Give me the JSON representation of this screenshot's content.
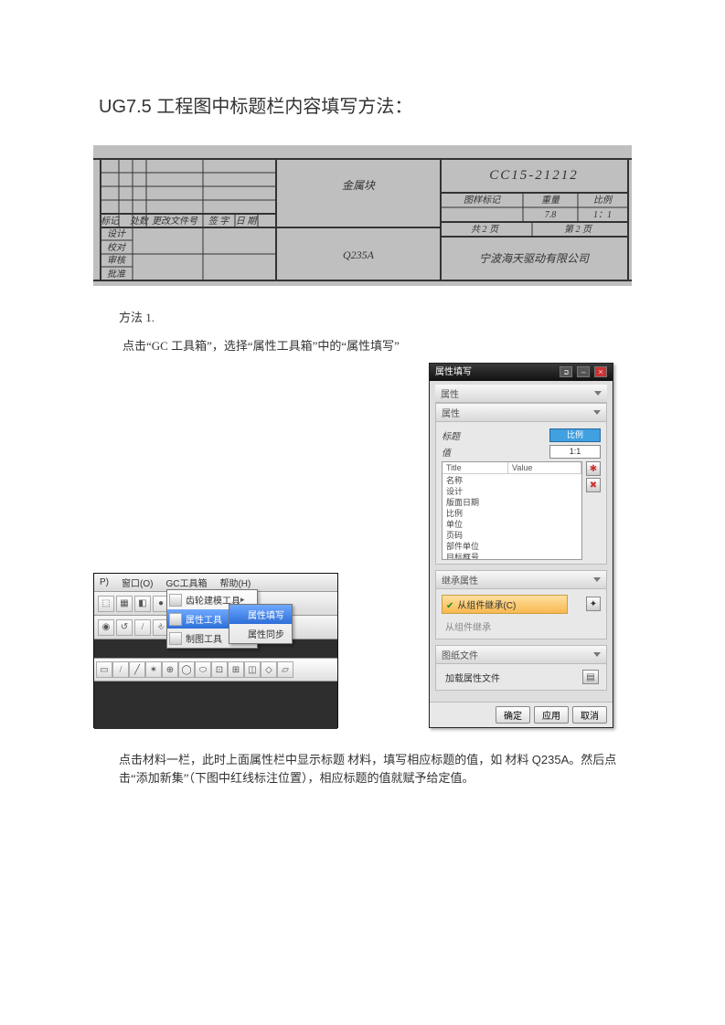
{
  "title_prefix": "UG7.5",
  "title_rest": " 工程图中标题栏内容填写方法：",
  "titleblock": {
    "part_no": "CC15-21212",
    "part_name": "金属块",
    "material": "Q235A",
    "hdr_mark": "标记",
    "hdr_place": "处数",
    "hdr_file": "更改文件号",
    "hdr_sign": "签 字",
    "hdr_date": "日 期",
    "row_design": "设计",
    "row_check": "校对",
    "row_review": "审核",
    "row_approve": "批准",
    "lbl_drawmark": "图样标记",
    "lbl_weight": "重量",
    "lbl_scale": "比例",
    "val_weight": "7.8",
    "val_scale": "1：1",
    "sheet_total": "共 2 页",
    "sheet_this": "第 2 页",
    "company": "宁波海天驱动有限公司"
  },
  "method_label": "方法 1.",
  "step1_text": "点击“GC 工具箱”，选择“属性工具箱”中的“属性填写”",
  "menubar": {
    "a": "P)",
    "b": "窗口(O)",
    "c": "GC工具箱",
    "d": "帮助(H)"
  },
  "main_menu": {
    "m1": "齿轮建模工具",
    "m2": "属性工具",
    "m3": "制图工具"
  },
  "sub_menu": {
    "s1": "属性填写",
    "s2": "属性同步"
  },
  "dialog": {
    "title": "属性填写",
    "sec_props": "属性",
    "sec_props2": "属性",
    "lbl_title": "标题",
    "lbl_value": "值",
    "val_title": "比例",
    "val_value": "1:1",
    "col_title": "Title",
    "col_value": "Value",
    "rows": [
      "名称",
      "设计",
      "版面日期",
      "比例",
      "单位",
      "页码",
      "部件单位",
      "目标框号"
    ],
    "sec_inherit": "继承属性",
    "inherit_from": "从组件继承(C)",
    "inherit_from2": "从组件继承",
    "sec_file": "图纸文件",
    "load_file": "加载属性文件",
    "btn_ok": "确定",
    "btn_apply": "应用",
    "btn_cancel": "取消"
  },
  "para2_a": "点击材料一栏，此时上面属性栏中显示标题 材料，填写相应标题的值，如 材料 ",
  "para2_b": "Q235A",
  "para2_c": "。然后点击“添加新集”（下图中红线标注位置），相应标题的值就赋予给定值。"
}
